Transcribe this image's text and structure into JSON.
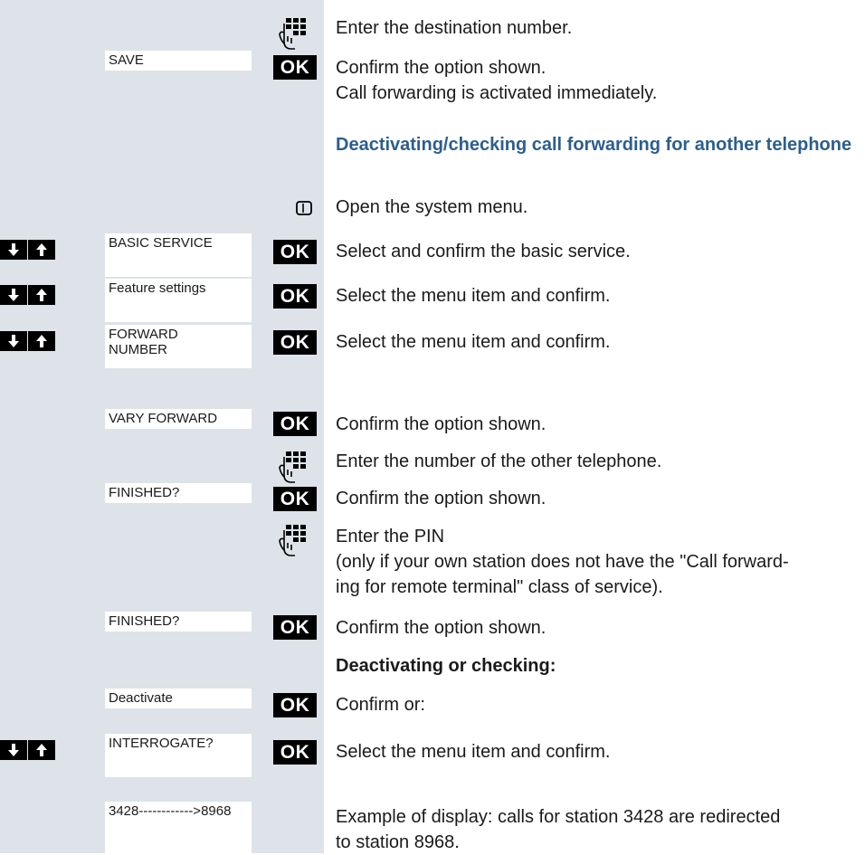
{
  "displays": {
    "save": "SAVE",
    "basic_service": "BASIC SERVICE",
    "feature_settings": "Feature settings",
    "forward_number": "FORWARD\nNUMBER",
    "vary_forward": "VARY FORWARD",
    "finished_1": "FINISHED?",
    "finished_2": "FINISHED?",
    "deactivate": "Deactivate",
    "interrogate": "INTERROGATE?",
    "example": "3428------------>8968"
  },
  "keys": {
    "ok_label": "OK",
    "keypad_icon": "keypad-hand-icon",
    "menu_icon": "menu-key-icon",
    "down_icon": "arrow-down-icon",
    "up_icon": "arrow-up-icon"
  },
  "steps": {
    "s1": "Enter the destination number.",
    "s2": "Confirm the option shown.\nCall forwarding is activated immediately.",
    "heading": "Deactivating/checking call forwarding for another telephone",
    "s3": "Open the system menu.",
    "s4": "Select and confirm the basic service.",
    "s5": "Select the menu item and confirm.",
    "s6": "Select the menu item and confirm.",
    "s7": "Confirm the option shown.",
    "s8": "Enter the number of the other telephone.",
    "s9": "Confirm the option shown.",
    "s10": "Enter the PIN\n(only if your own station does not have the \"Call forward-\ning for remote terminal\" class of service).",
    "s11": "Confirm the option shown.",
    "subheading": "Deactivating or checking:",
    "s12": "Confirm or:",
    "s13": "Select the menu item and confirm.",
    "s14": "Example of display: calls for station 3428 are redirected\nto station 8968."
  },
  "colors": {
    "sidebar_bg": "#dde3e8",
    "heading": "#2c5e8e",
    "key_bg": "#000000"
  }
}
